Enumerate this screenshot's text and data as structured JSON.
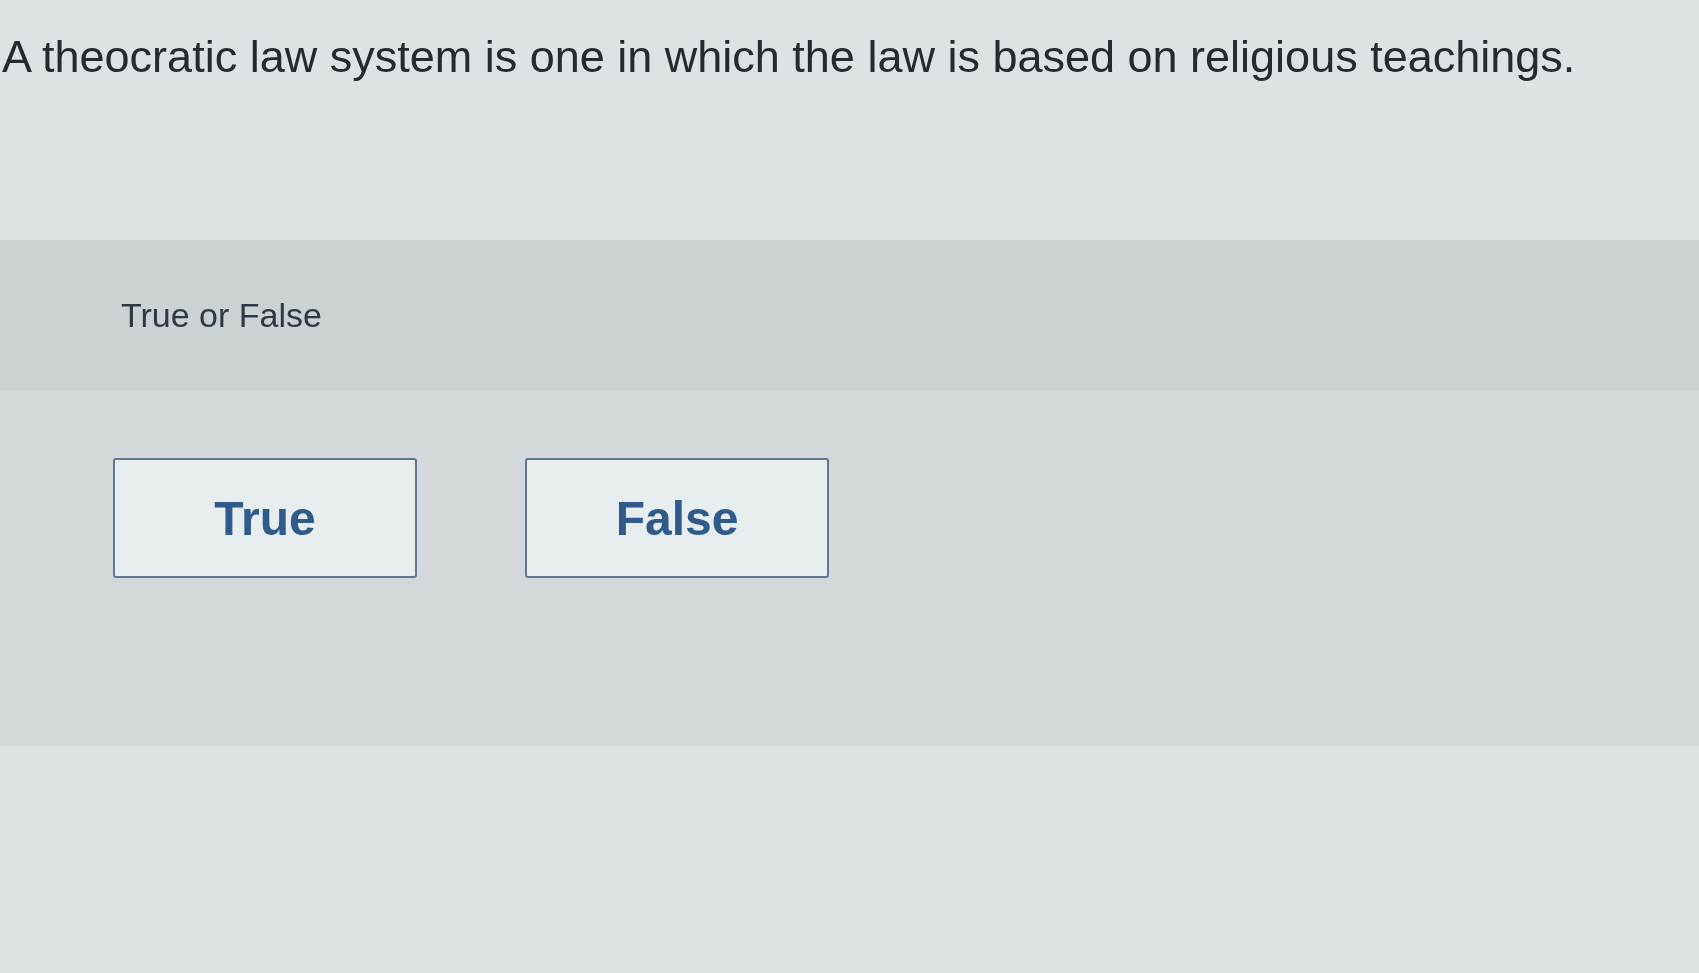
{
  "question": {
    "text": "A theocratic law system is one in which the law is based on religious teachings."
  },
  "prompt": "True or False",
  "options": [
    {
      "label": "True",
      "selected": false
    },
    {
      "label": "False",
      "selected": false
    }
  ]
}
